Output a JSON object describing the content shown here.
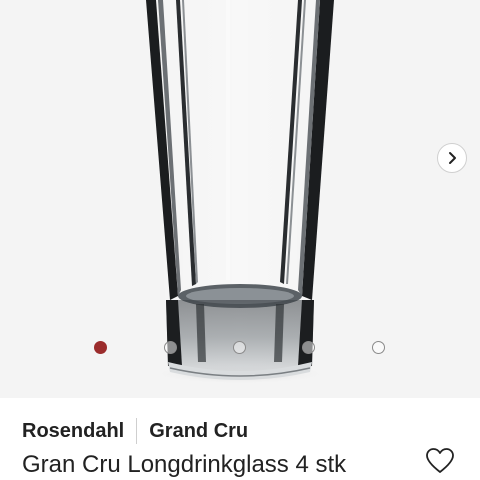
{
  "product": {
    "brand": "Rosendahl",
    "collection": "Grand Cru",
    "title": "Gran Cru Longdrinkglass 4 stk"
  },
  "gallery": {
    "image_count": 5,
    "active_index": 0,
    "active_dot_color": "#9b2c2c",
    "background_color": "#f4f4f4"
  },
  "icons": {
    "next": "chevron-right-icon",
    "wishlist": "heart-outline-icon"
  }
}
